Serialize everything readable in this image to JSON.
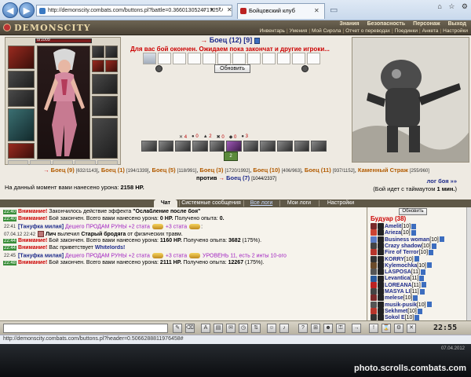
{
  "browser": {
    "address": "http://demonscity.combats.com/buttons.pl?battle=0.366013052471725",
    "tab_title": "Бойцовский клуб",
    "status_url": "http://demonscity.combats.com/buttons.pl?header=0.5066288811976458#"
  },
  "header": {
    "logo": "DEMONSCITY",
    "menu_top": [
      "Знания",
      "Безопасность",
      "Персонаж",
      "Выход"
    ],
    "menu_sub": [
      "Инвентарь",
      "Умения",
      "Мой Сирола",
      "Отчет о переводах",
      "Поединки",
      "Анкета",
      "Настройки"
    ]
  },
  "player": {
    "hp": "0/1009"
  },
  "fight": {
    "fighter_name": "Боец",
    "fighter_level": "(12)",
    "fighter_extra": "[9]",
    "wait_message": "Для вас бой окончен. Ожидаем пока закончат и другие игроки...",
    "refresh_label": "Обновить",
    "stats": [
      "4",
      "0",
      "2",
      "0",
      "0",
      "3"
    ],
    "badge": "2"
  },
  "battle": {
    "team": [
      {
        "name": "Боец",
        "lvl": "(9)",
        "hp": "[632/1143]"
      },
      {
        "name": "Боец",
        "lvl": "(1)",
        "hp": "[194/1339]"
      },
      {
        "name": "Боец",
        "lvl": "(5)",
        "hp": "[118/991]"
      },
      {
        "name": "Боец",
        "lvl": "(3)",
        "hp": "[1720/1992]"
      },
      {
        "name": "Боец",
        "lvl": "(10)",
        "hp": "[406/963]"
      },
      {
        "name": "Боец",
        "lvl": "(11)",
        "hp": "[937/1152]"
      },
      {
        "name": "Каменный Страж",
        "lvl": "",
        "hp": "[255/960]"
      }
    ],
    "vs_word": "против",
    "enemy_name": "Боец",
    "enemy_lvl": "(7)",
    "enemy_hp": "[1044/2337]",
    "log_link": "лог боя »»",
    "damage_text": "На данный момент вами нанесено урона:",
    "damage_value": "2158 HP.",
    "timeout_text": "(Бой идет с таймаутом",
    "timeout_value": "1 мин.",
    "timeout_end": ")"
  },
  "tabs": [
    "Чат",
    "Системные сообщения",
    "Все логи",
    "Мои логи",
    "Настройки"
  ],
  "chat": {
    "warn": "Внимание!",
    "l1_ts": "22:40",
    "l1_text": "Закончилось действие эффекта",
    "l1_effect": "\"Ослабление после боя\"",
    "l2_ts": "22:40",
    "l2_text": "Бой закончен. Всего вами нанесено урона:",
    "l2_val": "0 HP.",
    "l2_tail": "Получено опыта:",
    "l2_exp": "0.",
    "l3_ts": "22:41",
    "l3_nick": "[Тануфка милая]",
    "l3_promo": "Дешего ПРОДАМ РУНЫ +2 стата",
    "l3_promo2": "+3 стата",
    "l4_ts": "07.04.12 22:42",
    "l4_nick": "Лич",
    "l4_text": "вылечил",
    "l4_target": "Старый бродяга",
    "l4_tail": "от физических травм.",
    "l5_ts": "22:44",
    "l5_text": "Бой закончен. Всего вами нанесено урона:",
    "l5_val": "1160 HP.",
    "l5_tail": "Получено опыта:",
    "l5_exp": "3682",
    "l5_pct": "(175%).",
    "l6_ts": "22:44",
    "l6_text": "Вас приветствует",
    "l6_name": "Whitelords!",
    "l7_ts": "22:45",
    "l7_nick": "[Тануфка милая]",
    "l7_promo": "Дешего ПРОДАМ РУНЫ +2 стата",
    "l7_promo2": "+3 стата",
    "l7_promo3": "УРОВЕНЬ 11, есть 2 инты 10-ого",
    "l8_ts": "22:48",
    "l8_text": "Бой закончен. Всего вами нанесено урона:",
    "l8_val": "2111 HP.",
    "l8_tail": "Получено опыта:",
    "l8_exp": "12267",
    "l8_pct": "(175%)."
  },
  "room": {
    "refresh": "Обновить",
    "title": "Будуар (38)",
    "users": [
      {
        "name": "Amelit",
        "lvl": "[10]"
      },
      {
        "name": "Arieza",
        "lvl": "[10]"
      },
      {
        "name": "Business woman",
        "lvl": "[10]"
      },
      {
        "name": "Crazy shadow",
        "lvl": "[10]"
      },
      {
        "name": "Fire of Terror",
        "lvl": "[10]"
      },
      {
        "name": "KORRY",
        "lvl": "[10]"
      },
      {
        "name": "Kylemochka",
        "lvl": "[10]"
      },
      {
        "name": "LASPOSA",
        "lvl": "[11]"
      },
      {
        "name": "Levantica",
        "lvl": "[11]"
      },
      {
        "name": "LOREANA",
        "lvl": "[11]"
      },
      {
        "name": "MASYA LI",
        "lvl": "[11]"
      },
      {
        "name": "melese",
        "lvl": "[10]"
      },
      {
        "name": "musik-pusik",
        "lvl": "[10]"
      },
      {
        "name": "Sekhmet",
        "lvl": "[10]"
      },
      {
        "name": "Sokol E",
        "lvl": "[10]"
      }
    ]
  },
  "clock": "22:55",
  "watermark": "photo.scrolls.combats.com",
  "taskbar_clock": "07.04.2012",
  "colors": {
    "accent": "#1d2a8a",
    "warning": "#cc0000",
    "frame": "#5f5847"
  }
}
